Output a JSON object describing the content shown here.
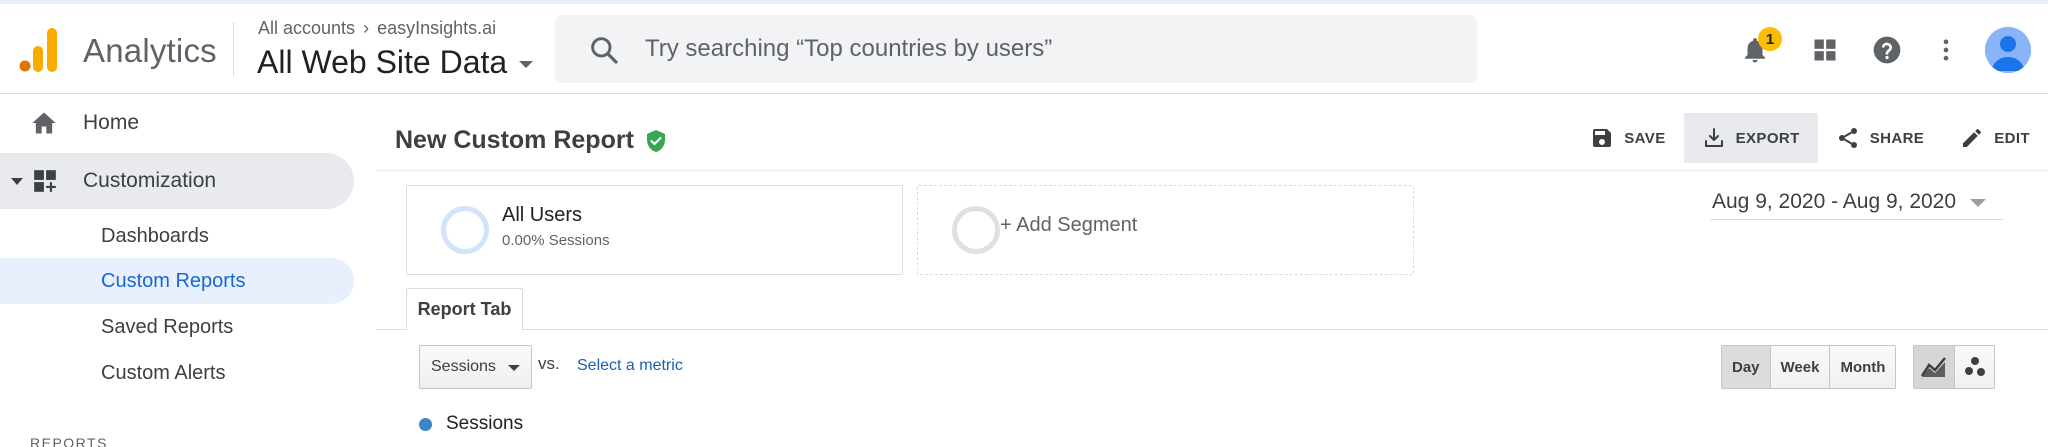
{
  "header": {
    "app_name": "Analytics",
    "breadcrumb": {
      "account_root": "All accounts",
      "separator": "›",
      "account": "easyInsights.ai"
    },
    "property_view": "All Web Site Data",
    "search": {
      "placeholder": "Try searching “Top countries by users”"
    },
    "notifications": {
      "count": "1"
    }
  },
  "sidebar": {
    "home": "Home",
    "customization": "Customization",
    "sub_items": [
      {
        "label": "Dashboards"
      },
      {
        "label": "Custom Reports"
      },
      {
        "label": "Saved Reports"
      },
      {
        "label": "Custom Alerts"
      }
    ],
    "section": "REPORTS"
  },
  "report": {
    "title": "New Custom Report",
    "actions": {
      "save": "SAVE",
      "export": "EXPORT",
      "share": "SHARE",
      "edit": "EDIT"
    },
    "segments": {
      "all_users": {
        "name": "All Users",
        "detail": "0.00% Sessions"
      },
      "add": "+ Add Segment"
    },
    "date_range": "Aug 9, 2020 - Aug 9, 2020",
    "tab": "Report Tab",
    "metric": {
      "selected": "Sessions",
      "vs": "vs.",
      "select_link": "Select a metric"
    },
    "granularity": {
      "day": "Day",
      "week": "Week",
      "month": "Month"
    },
    "legend": {
      "series": "Sessions",
      "color": "#3b86c6"
    }
  },
  "colors": {
    "active_nav_bg": "#e8f0fe",
    "active_nav_text": "#1967d2",
    "verified": "#34a853",
    "badge": "#fbbc04",
    "logo_orange": "#f9ab00",
    "logo_dark_orange": "#e37400"
  }
}
